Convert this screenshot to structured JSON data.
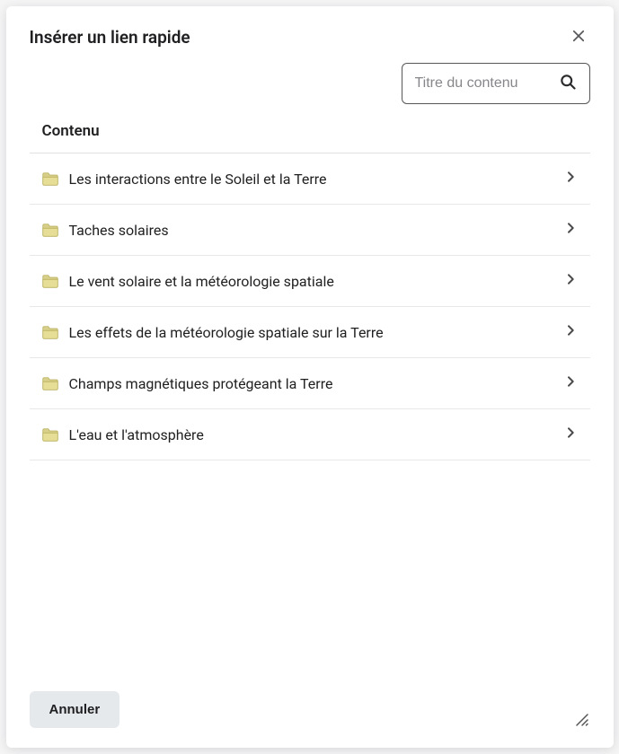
{
  "modal": {
    "title": "Insérer un lien rapide",
    "search_placeholder": "Titre du contenu",
    "section_label": "Contenu",
    "items": [
      {
        "label": "Les interactions entre le Soleil et la Terre"
      },
      {
        "label": "Taches solaires"
      },
      {
        "label": "Le vent solaire et la météorologie spatiale"
      },
      {
        "label": "Les effets de la météorologie spatiale sur la Terre"
      },
      {
        "label": "Champs magnétiques protégeant la Terre"
      },
      {
        "label": "L'eau et l'atmosphère"
      }
    ],
    "cancel_label": "Annuler"
  }
}
